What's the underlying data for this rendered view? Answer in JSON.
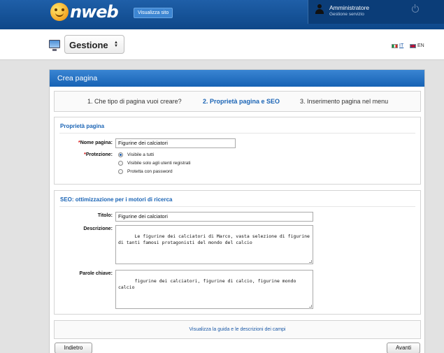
{
  "header": {
    "logo_text": "nweb",
    "view_site_label": "Visualizza sito",
    "user_name": "Amministratore",
    "user_role": "Gestione servizio"
  },
  "subheader": {
    "section_title": "Gestione",
    "languages": [
      {
        "code": "IT",
        "active": true
      },
      {
        "code": "EN",
        "active": false
      }
    ]
  },
  "panel": {
    "title": "Crea pagina",
    "steps": [
      {
        "label": "1. Che tipo di pagina vuoi creare?",
        "active": false
      },
      {
        "label": "2. Proprietà pagina e SEO",
        "active": true
      },
      {
        "label": "3. Inserimento pagina nel menu",
        "active": false
      }
    ],
    "properties": {
      "title": "Proprietà pagina",
      "name_label": "Nome pagina:",
      "name_value": "Figurine dei calciatori",
      "protection_label": "Protezione:",
      "required_mark": "*",
      "protection_options": [
        {
          "label": "Visibile a tutti",
          "checked": true
        },
        {
          "label": "Visibile solo agli utenti registrati",
          "checked": false
        },
        {
          "label": "Protetta con password",
          "checked": false
        }
      ]
    },
    "seo": {
      "title": "SEO: ottimizzazione per i motori di ricerca",
      "title_label": "Titolo:",
      "title_value": "Figurine dei calciatori",
      "description_label": "Descrizione:",
      "description_value": "Le figurine dei calciatori di Marco, vasta selezione di figurine di tanti famosi protagonisti del mondo del calcio",
      "keywords_label": "Parole chiave:",
      "keywords_value": "figurine dei calciatori, figurine di calcio, figurine mondo calcio"
    },
    "guide_link": "Visualizza la guida e le descrizioni dei campi",
    "back_label": "Indietro",
    "next_label": "Avanti"
  },
  "colors": {
    "header_blue": "#0d4789",
    "accent_blue": "#1a64b5",
    "required_red": "#cc0000"
  }
}
